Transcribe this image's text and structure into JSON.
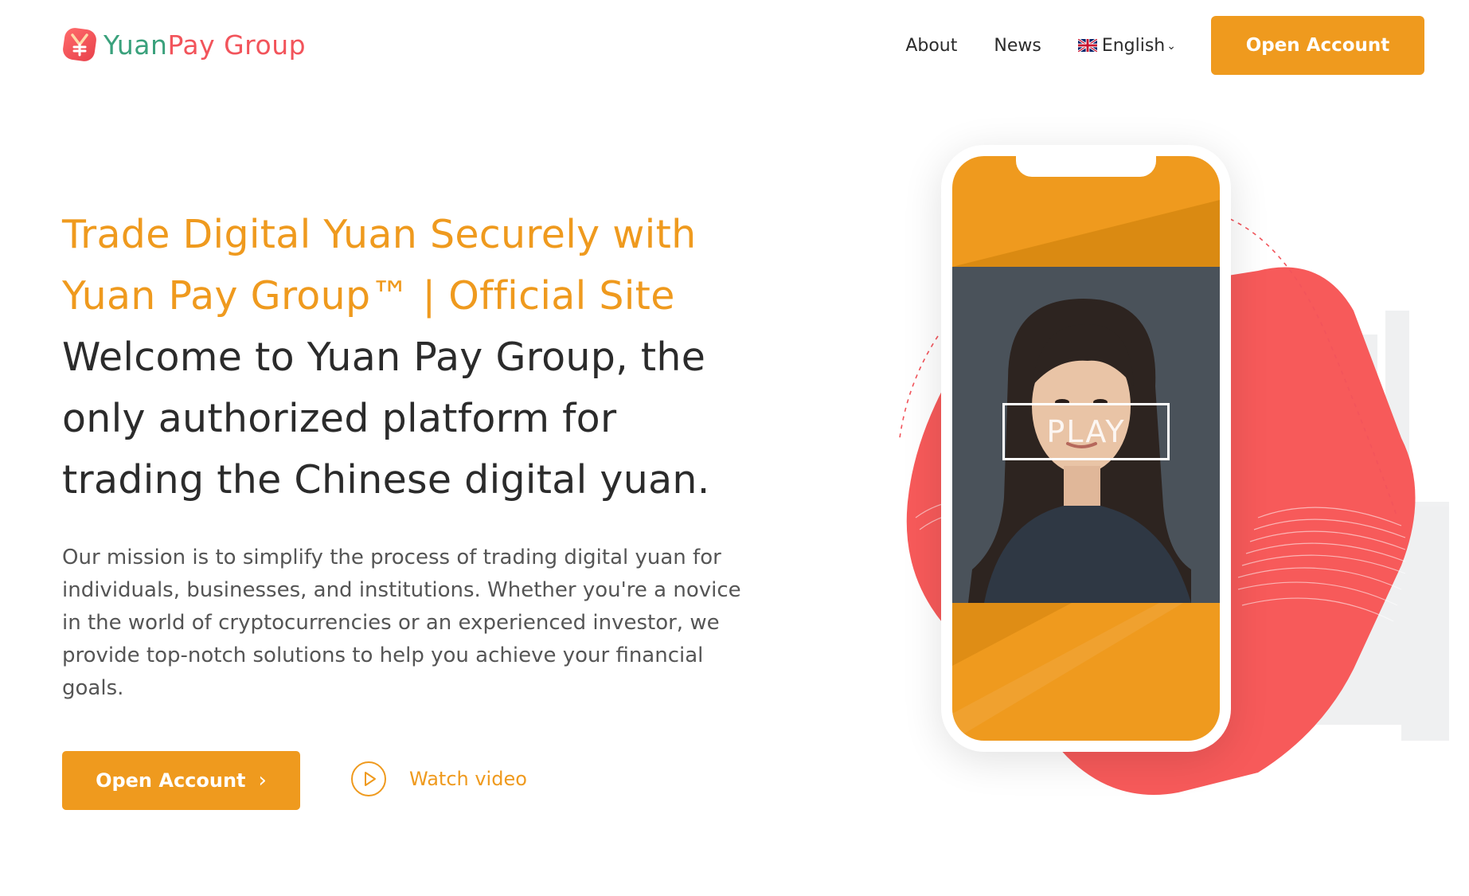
{
  "brand": {
    "name_part1": "Yuan",
    "name_part2": "Pay Group",
    "colors": {
      "accent_orange": "#ef9a1e",
      "brand_red": "#f2545b",
      "brand_green": "#3aa17c"
    }
  },
  "nav": {
    "about": "About",
    "news": "News",
    "language": "English",
    "language_flag_icon": "uk-flag-icon",
    "open_account": "Open Account"
  },
  "hero": {
    "title": "Trade Digital Yuan Securely with Yuan Pay Group™ | Official Site",
    "subtitle": "Welcome to Yuan Pay Group, the only authorized platform for trading the Chinese digital yuan.",
    "description": "Our mission is to simplify the process of trading digital yuan for individuals, businesses, and institutions. Whether you're a novice in the world of cryptocurrencies or an experienced investor, we provide top-notch solutions to help you achieve your financial goals.",
    "cta_label": "Open Account",
    "cta_icon": "chevron-right-icon",
    "watch_label": "Watch video",
    "watch_icon": "play-circle-icon"
  },
  "video": {
    "play_label": "PLAY"
  }
}
